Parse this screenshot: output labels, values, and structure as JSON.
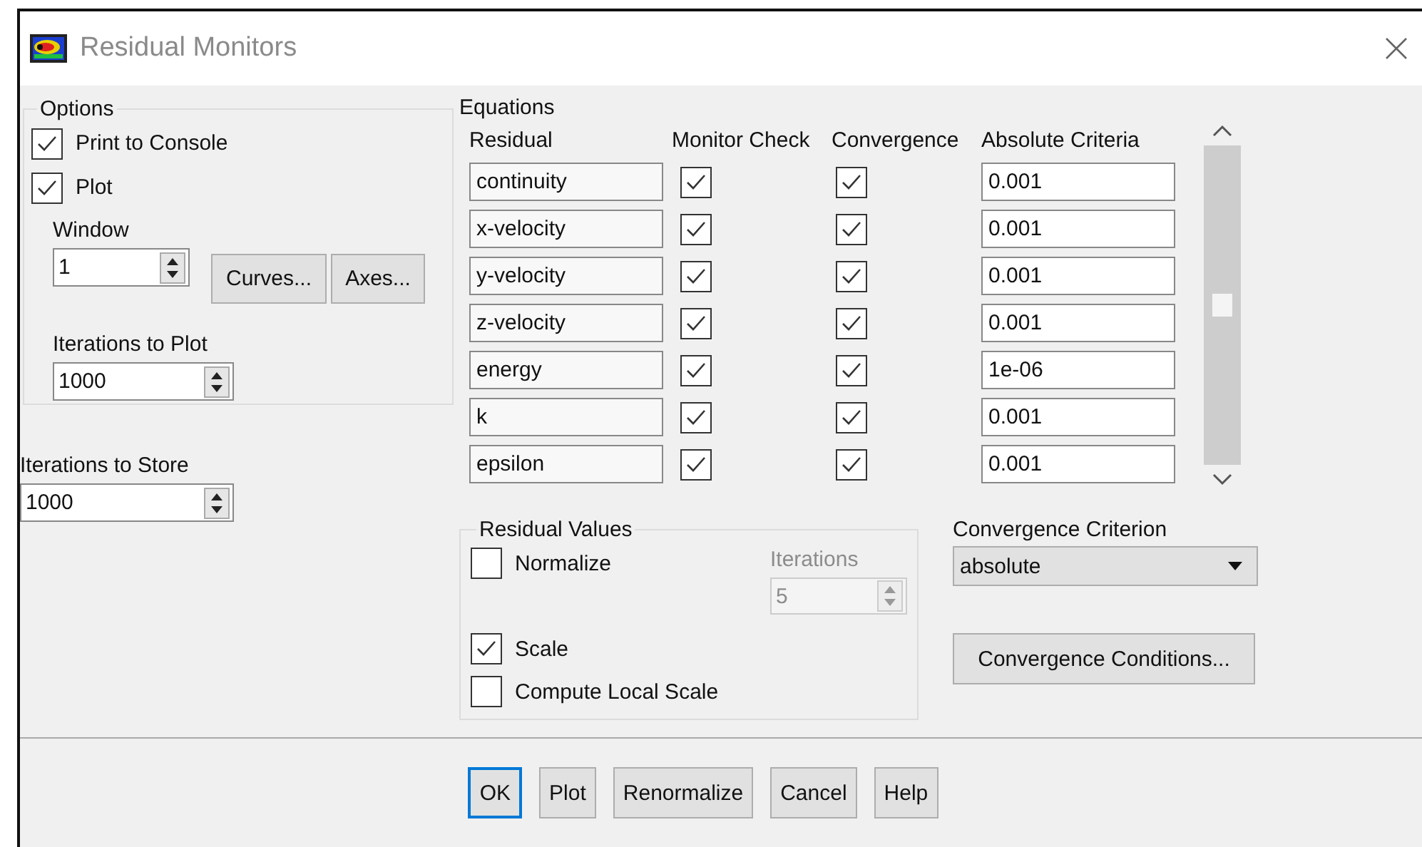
{
  "window": {
    "title": "Residual Monitors"
  },
  "options": {
    "legend": "Options",
    "checks": [
      {
        "label": "Print to Console",
        "checked": true
      },
      {
        "label": "Plot",
        "checked": true
      }
    ],
    "window_label": "Window",
    "window_value": "1",
    "curves_button": "Curves...",
    "axes_button": "Axes...",
    "iterations_to_plot_label": "Iterations to Plot",
    "iterations_to_plot": "1000"
  },
  "iterations_to_store": {
    "label": "Iterations to Store",
    "value": "1000"
  },
  "equations": {
    "title": "Equations",
    "columns": [
      "Residual",
      "Monitor Check",
      "Convergence",
      "Absolute Criteria"
    ],
    "rows": [
      {
        "residual": "continuity",
        "monitor": true,
        "convergence": true,
        "criteria": "0.001"
      },
      {
        "residual": "x-velocity",
        "monitor": true,
        "convergence": true,
        "criteria": "0.001"
      },
      {
        "residual": "y-velocity",
        "monitor": true,
        "convergence": true,
        "criteria": "0.001"
      },
      {
        "residual": "z-velocity",
        "monitor": true,
        "convergence": true,
        "criteria": "0.001"
      },
      {
        "residual": "energy",
        "monitor": true,
        "convergence": true,
        "criteria": "1e-06"
      },
      {
        "residual": "k",
        "monitor": true,
        "convergence": true,
        "criteria": "0.001"
      },
      {
        "residual": "epsilon",
        "monitor": true,
        "convergence": true,
        "criteria": "0.001"
      }
    ]
  },
  "residual_values": {
    "legend": "Residual Values",
    "normalize": {
      "label": "Normalize",
      "checked": false
    },
    "iterations": {
      "label": "Iterations",
      "value": "5",
      "disabled": true
    },
    "others": [
      {
        "label": "Scale",
        "checked": true
      },
      {
        "label": "Compute Local Scale",
        "checked": false
      }
    ]
  },
  "convergence_criterion": {
    "label": "Convergence Criterion",
    "value": "absolute"
  },
  "convergence_conditions_button": "Convergence Conditions...",
  "buttons": [
    {
      "label": "OK",
      "focused": true
    },
    {
      "label": "Plot",
      "focused": false
    },
    {
      "label": "Renormalize",
      "focused": false
    },
    {
      "label": "Cancel",
      "focused": false
    },
    {
      "label": "Help",
      "focused": false
    }
  ]
}
